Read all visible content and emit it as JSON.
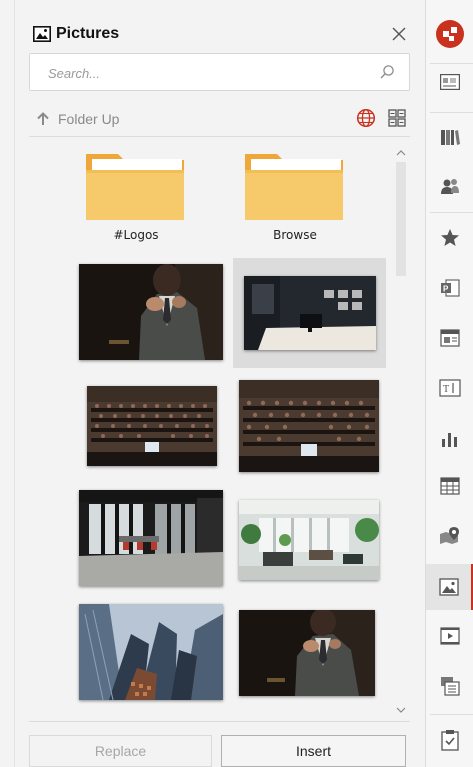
{
  "panel": {
    "title": "Pictures",
    "search": {
      "placeholder": "Search..."
    },
    "folder_up_label": "Folder Up",
    "folders": [
      {
        "label": "#Logos"
      },
      {
        "label": "Browse"
      }
    ],
    "images": [
      {
        "subject": "man adjusting tie, dark suit",
        "selected": false
      },
      {
        "subject": "dark office with desk and monitor",
        "selected": true
      },
      {
        "subject": "audience in lecture hall",
        "selected": false
      },
      {
        "subject": "audience in lecture hall",
        "selected": false
      },
      {
        "subject": "modern office interior with chairs",
        "selected": false
      },
      {
        "subject": "bright office lounge with plants",
        "selected": false
      },
      {
        "subject": "skyscrapers from below",
        "selected": false
      },
      {
        "subject": "man adjusting tie, dark suit",
        "selected": false
      }
    ],
    "buttons": {
      "replace": "Replace",
      "insert": "Insert"
    }
  },
  "sidebar": {
    "items": [
      {
        "icon": "logo-icon"
      },
      {
        "icon": "text-styles-icon"
      },
      {
        "icon": "library-icon"
      },
      {
        "icon": "people-icon"
      },
      {
        "icon": "star-icon"
      },
      {
        "icon": "powerpoint-icon"
      },
      {
        "icon": "layout-icon"
      },
      {
        "icon": "text-box-icon"
      },
      {
        "icon": "bar-chart-icon"
      },
      {
        "icon": "table-icon"
      },
      {
        "icon": "map-pin-icon"
      },
      {
        "icon": "picture-icon",
        "active": true
      },
      {
        "icon": "video-icon"
      },
      {
        "icon": "slides-icon"
      },
      {
        "icon": "clipboard-check-icon"
      }
    ]
  },
  "colors": {
    "accent": "#c9321f",
    "folder": "#f6c96b",
    "folder_tab": "#f0a73a"
  }
}
